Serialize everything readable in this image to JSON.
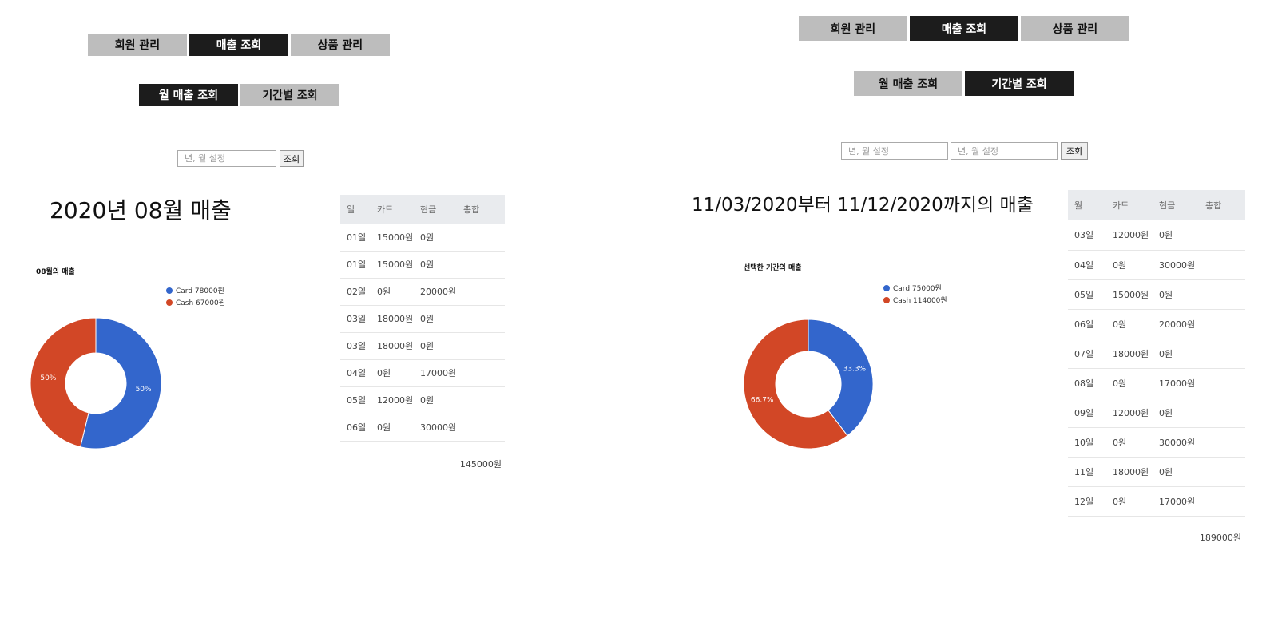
{
  "monthly_view": {
    "nav_tabs": [
      {
        "label": "회원 관리",
        "active": false
      },
      {
        "label": "매출 조회",
        "active": true
      },
      {
        "label": "상품 관리",
        "active": false
      }
    ],
    "sub_tabs": [
      {
        "label": "월 매출 조회",
        "active": true
      },
      {
        "label": "기간별 조회",
        "active": false
      }
    ],
    "month_input": {
      "placeholder": "년, 월 설정",
      "value": ""
    },
    "search_button": "조회",
    "heading": "2020년 08월 매출",
    "table": {
      "headers": [
        "일",
        "카드",
        "현금",
        "총합"
      ],
      "rows": [
        [
          "01일",
          "15000원",
          "0원",
          ""
        ],
        [
          "01일",
          "15000원",
          "0원",
          ""
        ],
        [
          "02일",
          "0원",
          "20000원",
          ""
        ],
        [
          "03일",
          "18000원",
          "0원",
          ""
        ],
        [
          "03일",
          "18000원",
          "0원",
          ""
        ],
        [
          "04일",
          "0원",
          "17000원",
          ""
        ],
        [
          "05일",
          "12000원",
          "0원",
          ""
        ],
        [
          "06일",
          "0원",
          "30000원",
          ""
        ]
      ],
      "total": "145000원"
    },
    "chart_data": {
      "type": "pie",
      "donut": true,
      "title": "08월의 매출",
      "legend_position": "top-right",
      "slices": [
        {
          "name": "Card",
          "legend_label": "Card 78000원",
          "value": 78000,
          "label": "50%",
          "color": "#3366cc"
        },
        {
          "name": "Cash",
          "legend_label": "Cash 67000원",
          "value": 67000,
          "label": "50%",
          "color": "#d24726"
        }
      ]
    }
  },
  "period_view": {
    "nav_tabs": [
      {
        "label": "회원 관리",
        "active": false
      },
      {
        "label": "매출 조회",
        "active": true
      },
      {
        "label": "상품 관리",
        "active": false
      }
    ],
    "sub_tabs": [
      {
        "label": "월 매출 조회",
        "active": false
      },
      {
        "label": "기간별 조회",
        "active": true
      }
    ],
    "start_input": {
      "placeholder": "년, 월 설정",
      "value": ""
    },
    "end_input": {
      "placeholder": "년, 월 설정",
      "value": ""
    },
    "search_button": "조회",
    "heading": "11/03/2020부터 11/12/2020까지의 매출",
    "table": {
      "headers": [
        "월",
        "카드",
        "현금",
        "총합"
      ],
      "rows": [
        [
          "03일",
          "12000원",
          "0원",
          ""
        ],
        [
          "04일",
          "0원",
          "30000원",
          ""
        ],
        [
          "05일",
          "15000원",
          "0원",
          ""
        ],
        [
          "06일",
          "0원",
          "20000원",
          ""
        ],
        [
          "07일",
          "18000원",
          "0원",
          ""
        ],
        [
          "08일",
          "0원",
          "17000원",
          ""
        ],
        [
          "09일",
          "12000원",
          "0원",
          ""
        ],
        [
          "10일",
          "0원",
          "30000원",
          ""
        ],
        [
          "11일",
          "18000원",
          "0원",
          ""
        ],
        [
          "12일",
          "0원",
          "17000원",
          ""
        ]
      ],
      "total": "189000원"
    },
    "chart_data": {
      "type": "pie",
      "donut": true,
      "title": "선택한 기간의 매출",
      "legend_position": "top-right",
      "slices": [
        {
          "name": "Card",
          "legend_label": "Card 75000원",
          "value": 75000,
          "label": "33.3%",
          "color": "#3366cc"
        },
        {
          "name": "Cash",
          "legend_label": "Cash 114000원",
          "value": 114000,
          "label": "66.7%",
          "color": "#d24726"
        }
      ]
    }
  }
}
